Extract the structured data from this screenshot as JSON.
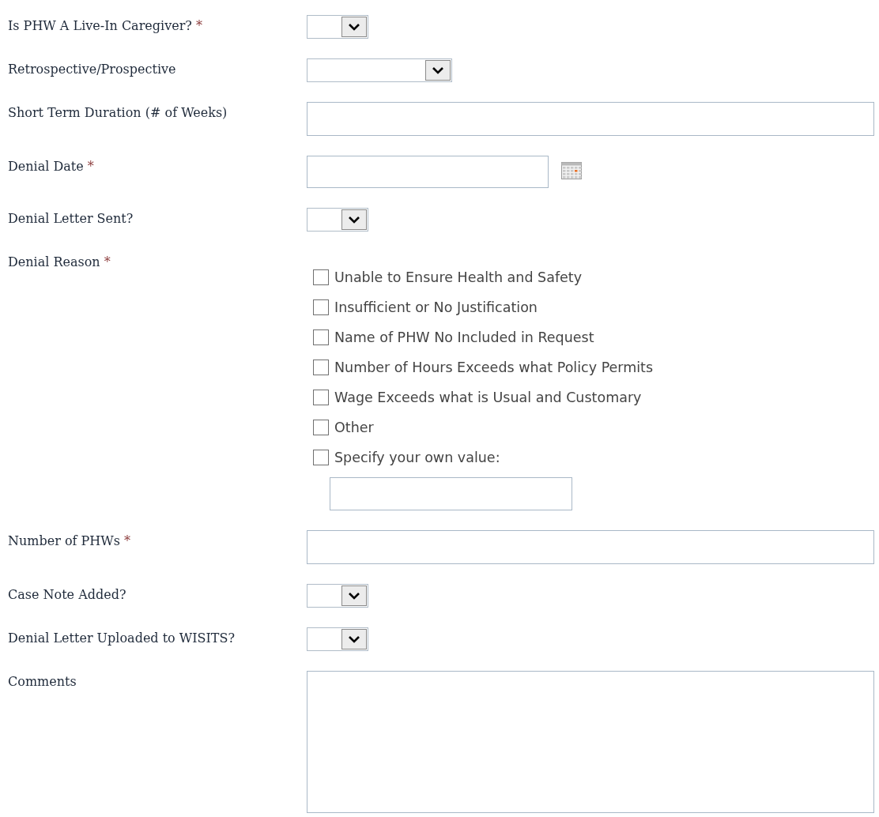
{
  "fields": [
    {
      "kind": "select",
      "label": "Is PHW A Live-In Caregiver?",
      "required_mark": "*"
    },
    {
      "kind": "wide_select",
      "label": "Retrospective/Prospective"
    },
    {
      "kind": "text",
      "label": "Short Term Duration (# of Weeks)"
    },
    {
      "kind": "date",
      "label": "Denial Date",
      "required_mark": "*"
    },
    {
      "kind": "select",
      "label": "Denial Letter Sent?"
    },
    {
      "kind": "checklist",
      "label": "Denial Reason",
      "required_mark": "*",
      "options": [
        {
          "label": "Unable to Ensure Health and Safety",
          "checked": false
        },
        {
          "label": "Insufficient or No Justification",
          "checked": false
        },
        {
          "label": "Name of PHW No Included in Request",
          "checked": false
        },
        {
          "label": "Number of Hours Exceeds what Policy Permits",
          "checked": false
        },
        {
          "label": "Wage Exceeds what is Usual and Customary",
          "checked": false
        },
        {
          "label": "Other",
          "checked": false
        },
        {
          "label": "Specify your own value:",
          "checked": false,
          "has_input": true
        }
      ]
    },
    {
      "kind": "text",
      "label": "Number of PHWs",
      "required_mark": "*"
    },
    {
      "kind": "select",
      "label": "Case Note Added?"
    },
    {
      "kind": "select",
      "label": "Denial Letter Uploaded to WISITS?"
    },
    {
      "kind": "textarea",
      "label": "Comments"
    }
  ]
}
